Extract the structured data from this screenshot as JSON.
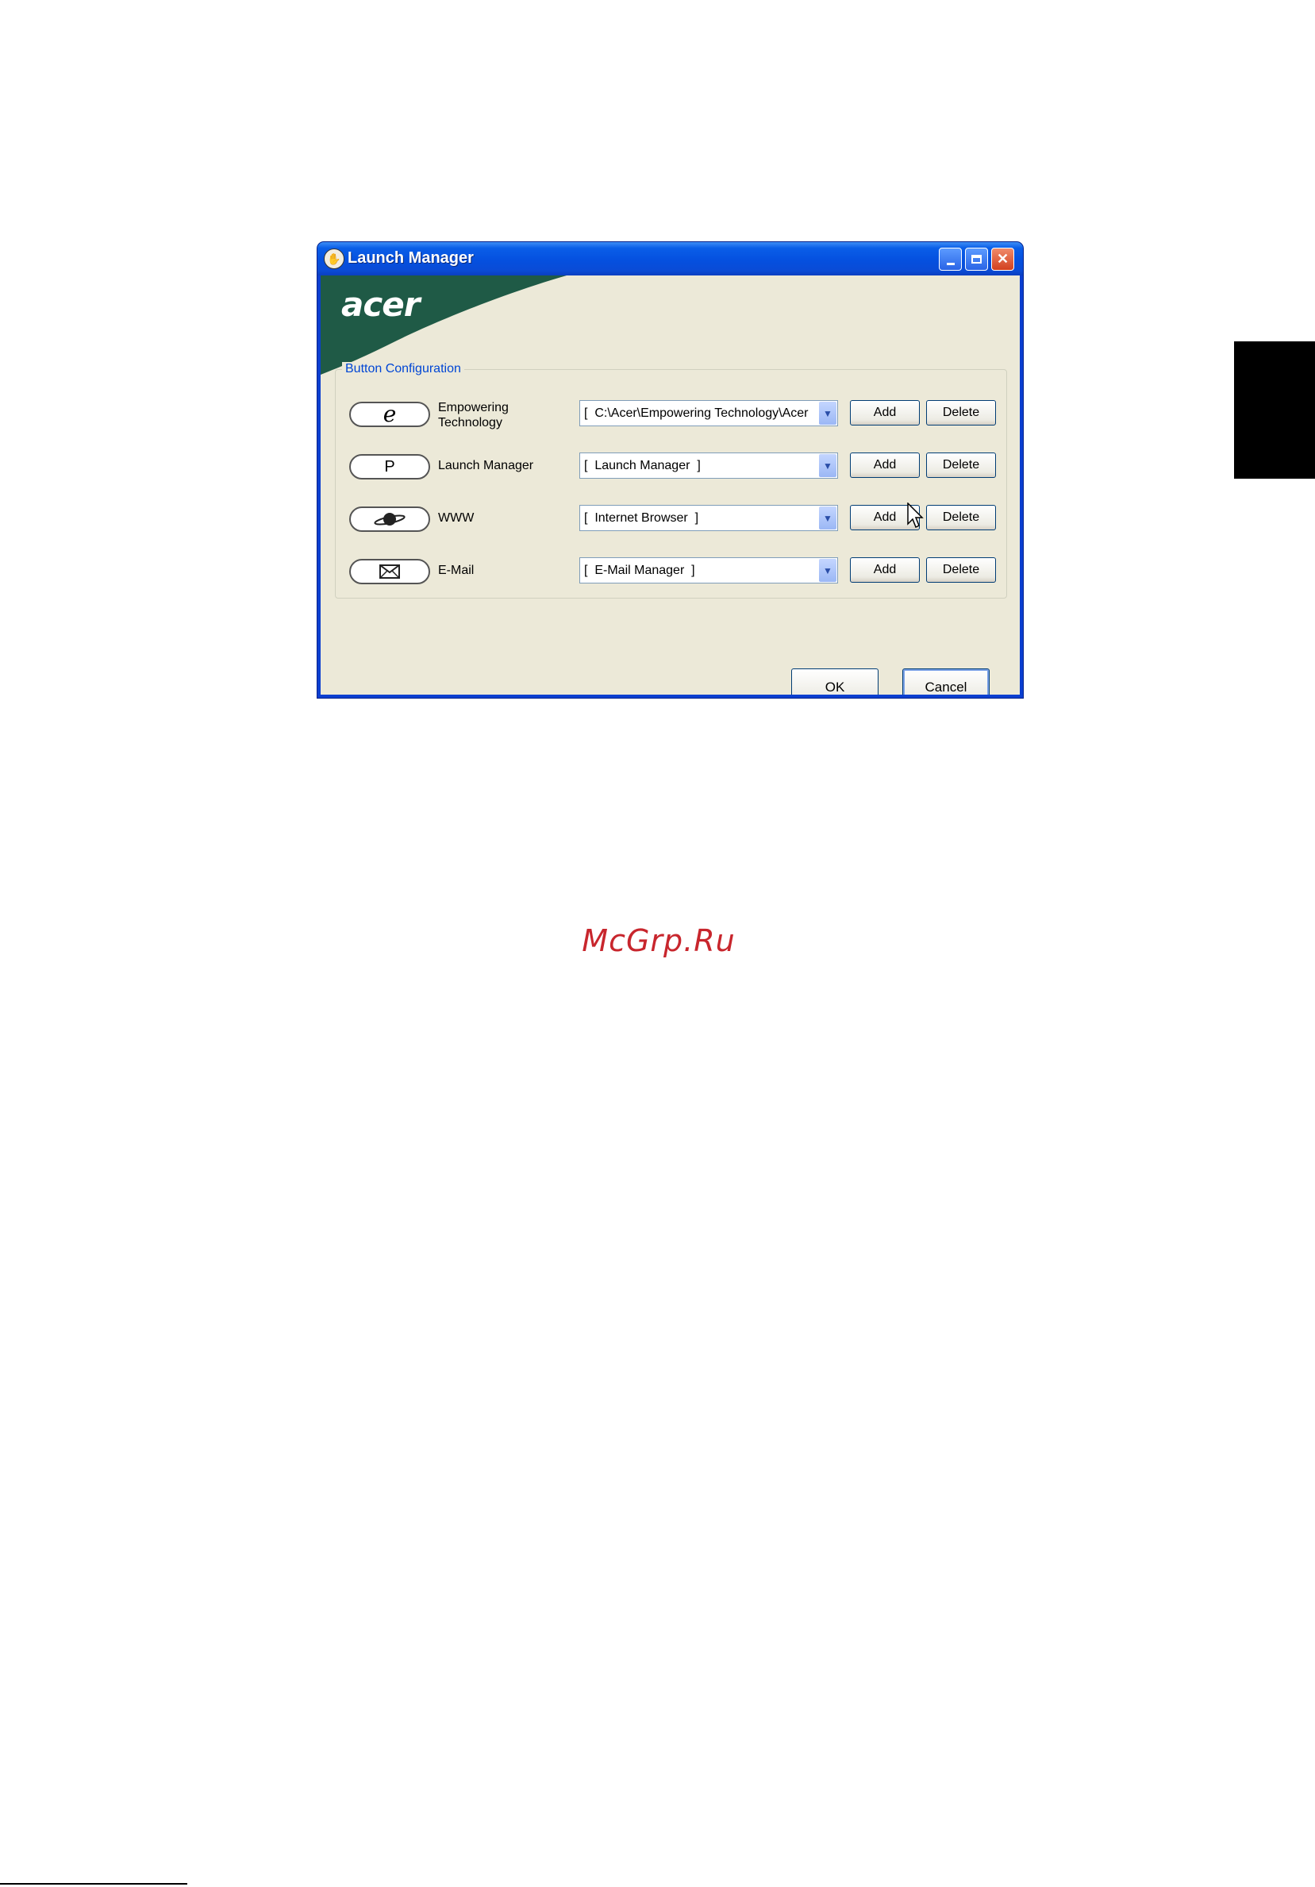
{
  "window": {
    "title": "Launch Manager",
    "brand": "acer",
    "group_label": "Button Configuration",
    "rows": [
      {
        "icon": "e-icon",
        "glyph": "e",
        "label": "Empowering Technology",
        "combo": "[  C:\\Acer\\Empowering Technology\\Acer",
        "add": "Add",
        "delete": "Delete"
      },
      {
        "icon": "p-icon",
        "glyph": "P",
        "label": "Launch Manager",
        "combo": "[  Launch Manager  ]",
        "add": "Add",
        "delete": "Delete"
      },
      {
        "icon": "planet-icon",
        "glyph": "",
        "label": "WWW",
        "combo": "[  Internet Browser  ]",
        "add": "Add",
        "delete": "Delete"
      },
      {
        "icon": "envelope-icon",
        "glyph": "",
        "label": "E-Mail",
        "combo": "[  E-Mail Manager  ]",
        "add": "Add",
        "delete": "Delete"
      }
    ],
    "ok": "OK",
    "cancel": "Cancel"
  },
  "page": {
    "watermark": "McGrp.Ru"
  },
  "colors": {
    "titlebar": "#0a5ee8",
    "dialog_bg": "#ece9d8",
    "acer_green": "#1f5a46",
    "group_label": "#0046d5",
    "watermark": "#c8262d"
  }
}
